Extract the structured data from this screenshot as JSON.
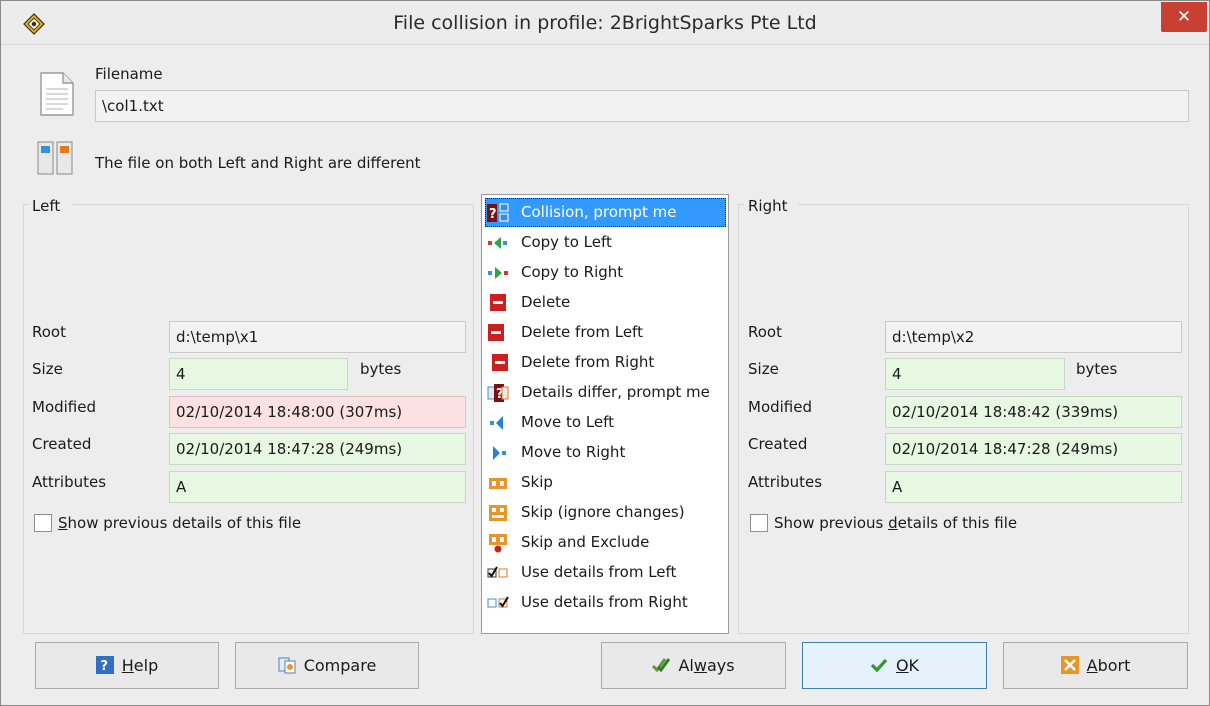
{
  "window": {
    "title": "File collision in profile: 2BrightSparks Pte Ltd",
    "close_glyph": "✕"
  },
  "filename": {
    "label": "Filename",
    "value": "\\col1.txt"
  },
  "status_text": "The file on both Left and Right are different",
  "left": {
    "group_label": "Left",
    "root_label": "Root",
    "root": "d:\\temp\\x1",
    "size_label": "Size",
    "size": "4",
    "bytes_label": "bytes",
    "modified_label": "Modified",
    "modified": "02/10/2014 18:48:00 (307ms)",
    "created_label": "Created",
    "created": "02/10/2014 18:47:28 (249ms)",
    "attributes_label": "Attributes",
    "attributes": "A",
    "show_prev": {
      "pre": "",
      "u": "S",
      "post": "how previous details of this file"
    }
  },
  "right": {
    "group_label": "Right",
    "root_label": "Root",
    "root": "d:\\temp\\x2",
    "size_label": "Size",
    "size": "4",
    "bytes_label": "bytes",
    "modified_label": "Modified",
    "modified": "02/10/2014 18:48:42 (339ms)",
    "created_label": "Created",
    "created": "02/10/2014 18:47:28 (249ms)",
    "attributes_label": "Attributes",
    "attributes": "A",
    "show_prev": {
      "pre": "Show previous ",
      "u": "d",
      "post": "etails of this file"
    }
  },
  "actions": [
    {
      "label": "Collision, prompt me",
      "icon": "collision-icon",
      "selected": true
    },
    {
      "label": "Copy to Left",
      "icon": "copy-left-icon"
    },
    {
      "label": "Copy to Right",
      "icon": "copy-right-icon"
    },
    {
      "label": "Delete",
      "icon": "delete-icon"
    },
    {
      "label": "Delete from Left",
      "icon": "delete-left-icon"
    },
    {
      "label": "Delete from Right",
      "icon": "delete-right-icon"
    },
    {
      "label": "Details differ, prompt me",
      "icon": "details-differ-icon"
    },
    {
      "label": "Move to Left",
      "icon": "move-left-icon"
    },
    {
      "label": "Move to Right",
      "icon": "move-right-icon"
    },
    {
      "label": "Skip",
      "icon": "skip-icon"
    },
    {
      "label": "Skip (ignore changes)",
      "icon": "skip-ignore-icon"
    },
    {
      "label": "Skip and Exclude",
      "icon": "skip-exclude-icon"
    },
    {
      "label": "Use details from Left",
      "icon": "use-left-icon"
    },
    {
      "label": "Use details from Right",
      "icon": "use-right-icon"
    }
  ],
  "buttons": {
    "help": {
      "pre": "",
      "u": "H",
      "post": "elp"
    },
    "compare": {
      "pre": "Compare",
      "u": "",
      "post": ""
    },
    "always": {
      "pre": "Al",
      "u": "w",
      "post": "ays"
    },
    "ok": {
      "pre": "",
      "u": "O",
      "post": "K"
    },
    "abort": {
      "pre": "",
      "u": "A",
      "post": "bort"
    }
  },
  "colors": {
    "selected": "#3399ff",
    "green_field": "#e6f7e2",
    "red_field": "#fbe1e2",
    "close_button": "#c84031"
  }
}
